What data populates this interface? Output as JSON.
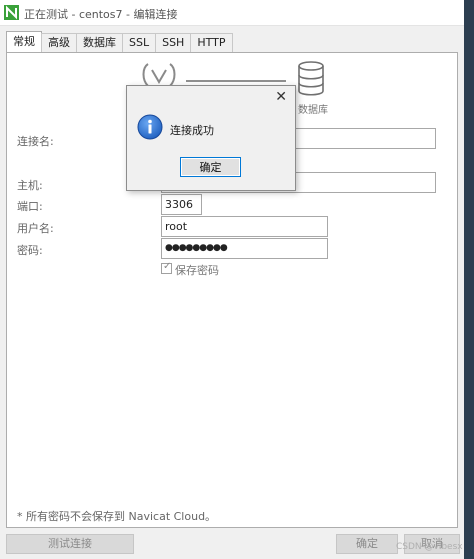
{
  "window": {
    "title": "正在测试 - centos7 - 编辑连接"
  },
  "tabs": [
    {
      "label": "常规",
      "active": true
    },
    {
      "label": "高级",
      "active": false
    },
    {
      "label": "数据库",
      "active": false
    },
    {
      "label": "SSL",
      "active": false
    },
    {
      "label": "SSH",
      "active": false
    },
    {
      "label": "HTTP",
      "active": false
    }
  ],
  "graphic": {
    "db_label": "数据库",
    "left_icon": "navicat-logo-icon",
    "right_icon": "database-icon"
  },
  "form": {
    "conn_name_label": "连接名:",
    "conn_name_value": "",
    "host_label": "主机:",
    "host_value": "",
    "port_label": "端口:",
    "port_value": "3306",
    "user_label": "用户名:",
    "user_value": "root",
    "password_label": "密码:",
    "password_value": "●●●●●●●●●",
    "save_password_label": "保存密码",
    "save_password_checked": true
  },
  "footnote": "* 所有密码不会保存到 Navicat Cloud。",
  "buttons": {
    "test_label": "测试连接",
    "ok_label": "确定",
    "cancel_label": "取消"
  },
  "watermark": "CSDN @vlbesx",
  "dialog": {
    "message": "连接成功",
    "ok_label": "确定",
    "close_glyph": "✕",
    "icon": "info-icon"
  },
  "colors": {
    "info_blue": "#1e5fbf",
    "logo_green": "#3aa13a",
    "accent": "#0078d7"
  }
}
